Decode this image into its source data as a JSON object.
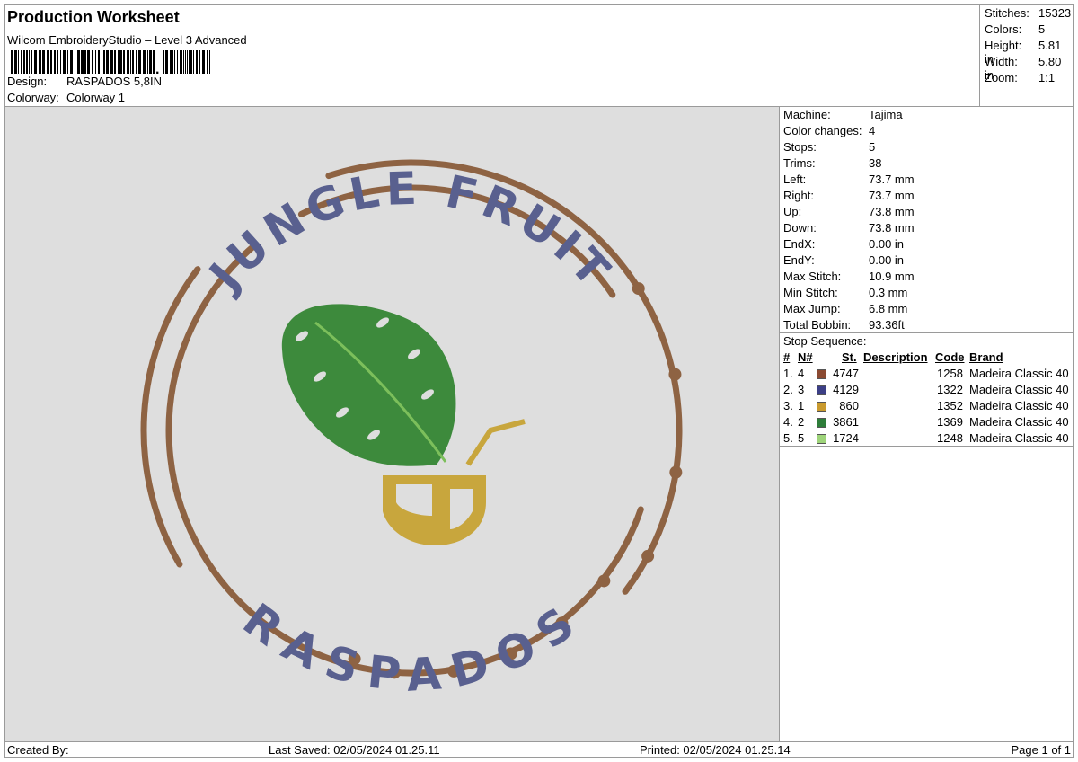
{
  "header": {
    "title": "Production Worksheet",
    "software": "Wilcom EmbroideryStudio – Level 3 Advanced",
    "design_label": "Design:",
    "design_value": "RASPADOS 5,8IN",
    "colorway_label": "Colorway:",
    "colorway_value": "Colorway 1"
  },
  "summary": [
    {
      "label": "Stitches:",
      "value": "15323"
    },
    {
      "label": "Colors:",
      "value": "5"
    },
    {
      "label": "Height:",
      "value": "5.81 in"
    },
    {
      "label": "Width:",
      "value": "5.80 in"
    },
    {
      "label": "Zoom:",
      "value": "1:1"
    }
  ],
  "properties": [
    {
      "label": "Machine:",
      "value": "Tajima"
    },
    {
      "label": "Color changes:",
      "value": "4"
    },
    {
      "label": "Stops:",
      "value": "5"
    },
    {
      "label": "Trims:",
      "value": "38"
    },
    {
      "label": "Left:",
      "value": "73.7 mm"
    },
    {
      "label": "Right:",
      "value": "73.7 mm"
    },
    {
      "label": "Up:",
      "value": "73.8 mm"
    },
    {
      "label": "Down:",
      "value": "73.8 mm"
    },
    {
      "label": "EndX:",
      "value": "0.00 in"
    },
    {
      "label": "EndY:",
      "value": "0.00 in"
    },
    {
      "label": "Max Stitch:",
      "value": "10.9 mm"
    },
    {
      "label": "Min Stitch:",
      "value": "0.3 mm"
    },
    {
      "label": "Max Jump:",
      "value": "6.8 mm"
    },
    {
      "label": "Total Bobbin:",
      "value": "93.36ft"
    }
  ],
  "stop_sequence": {
    "title": "Stop Sequence:",
    "headers": {
      "num": "#",
      "n": "N#",
      "st": "St.",
      "description": "Description",
      "code": "Code",
      "brand": "Brand"
    },
    "rows": [
      {
        "num": "1.",
        "n": "4",
        "color": "#8b4a32",
        "st": "4747",
        "code": "1258",
        "brand": "Madeira Classic 40"
      },
      {
        "num": "2.",
        "n": "3",
        "color": "#3c3f86",
        "st": "4129",
        "code": "1322",
        "brand": "Madeira Classic 40"
      },
      {
        "num": "3.",
        "n": "1",
        "color": "#c99a2e",
        "st": "860",
        "code": "1352",
        "brand": "Madeira Classic 40"
      },
      {
        "num": "4.",
        "n": "2",
        "color": "#2e7d3a",
        "st": "3861",
        "code": "1369",
        "brand": "Madeira Classic 40"
      },
      {
        "num": "5.",
        "n": "5",
        "color": "#9ed47a",
        "st": "1724",
        "code": "1248",
        "brand": "Madeira Classic 40"
      }
    ]
  },
  "design_art": {
    "top_text": "JUNGLE FRUIT",
    "bottom_text": "RASPADOS",
    "ring_color": "#8e6343",
    "text_color": "#59608f",
    "leaf_color": "#3d8a3c",
    "leaf_light": "#7cbf5b",
    "cup_color": "#c8a63d"
  },
  "footer": {
    "created_by": "Created By:",
    "last_saved": "Last Saved: 02/05/2024 01.25.11",
    "printed": "Printed: 02/05/2024 01.25.14",
    "page": "Page 1 of 1"
  }
}
